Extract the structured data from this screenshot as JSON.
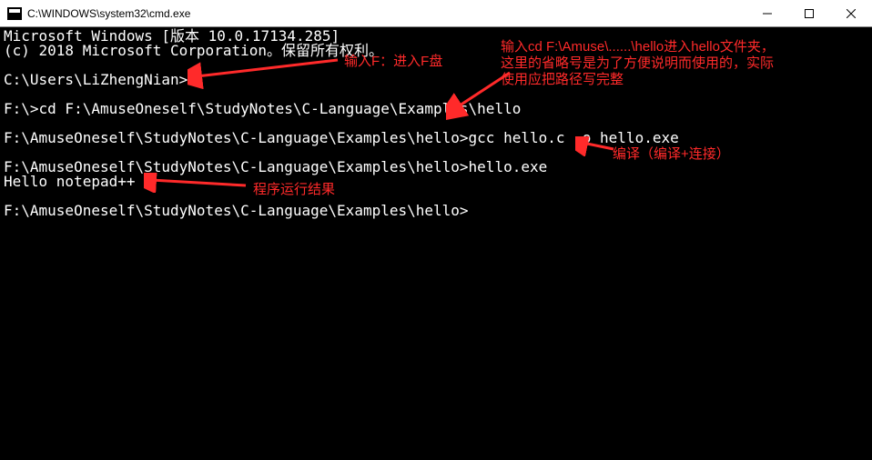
{
  "titlebar": {
    "title": "C:\\WINDOWS\\system32\\cmd.exe"
  },
  "console": {
    "lines": [
      "Microsoft Windows [版本 10.0.17134.285]",
      "(c) 2018 Microsoft Corporation。保留所有权利。",
      "C:\\Users\\LiZhengNian>F:",
      "F:\\>cd F:\\AmuseOneself\\StudyNotes\\C-Language\\Examples\\hello",
      "F:\\AmuseOneself\\StudyNotes\\C-Language\\Examples\\hello>gcc hello.c -o hello.exe",
      "F:\\AmuseOneself\\StudyNotes\\C-Language\\Examples\\hello>hello.exe",
      "Hello notepad++",
      "F:\\AmuseOneself\\StudyNotes\\C-Language\\Examples\\hello>"
    ]
  },
  "annotations": [
    {
      "text": "输入F：进入F盘"
    },
    {
      "text": "输入cd F:\\Amuse\\......\\hello进入hello文件夹，\n这里的省略号是为了方便说明而使用的，实际\n使用应把路径写完整"
    },
    {
      "text": "编译（编译+连接）"
    },
    {
      "text": "程序运行结果"
    }
  ],
  "colors": {
    "annotation": "#ff2a2a",
    "console_bg": "#000000",
    "console_fg": "#ffffff"
  }
}
